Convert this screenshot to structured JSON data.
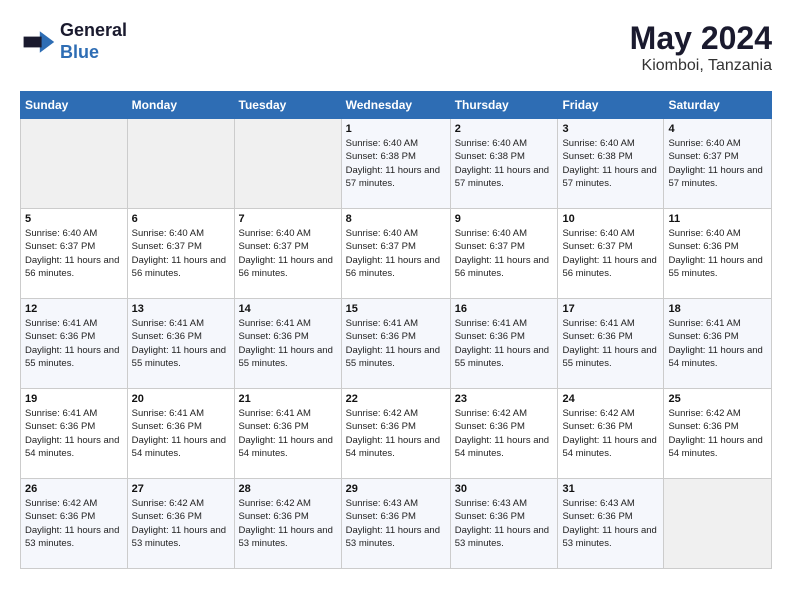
{
  "header": {
    "logo_line1": "General",
    "logo_line2": "Blue",
    "month_year": "May 2024",
    "location": "Kiomboi, Tanzania"
  },
  "days_of_week": [
    "Sunday",
    "Monday",
    "Tuesday",
    "Wednesday",
    "Thursday",
    "Friday",
    "Saturday"
  ],
  "weeks": [
    [
      {
        "day": "",
        "sunrise": "",
        "sunset": "",
        "daylight": "",
        "empty": true
      },
      {
        "day": "",
        "sunrise": "",
        "sunset": "",
        "daylight": "",
        "empty": true
      },
      {
        "day": "",
        "sunrise": "",
        "sunset": "",
        "daylight": "",
        "empty": true
      },
      {
        "day": "1",
        "sunrise": "Sunrise: 6:40 AM",
        "sunset": "Sunset: 6:38 PM",
        "daylight": "Daylight: 11 hours and 57 minutes.",
        "empty": false
      },
      {
        "day": "2",
        "sunrise": "Sunrise: 6:40 AM",
        "sunset": "Sunset: 6:38 PM",
        "daylight": "Daylight: 11 hours and 57 minutes.",
        "empty": false
      },
      {
        "day": "3",
        "sunrise": "Sunrise: 6:40 AM",
        "sunset": "Sunset: 6:38 PM",
        "daylight": "Daylight: 11 hours and 57 minutes.",
        "empty": false
      },
      {
        "day": "4",
        "sunrise": "Sunrise: 6:40 AM",
        "sunset": "Sunset: 6:37 PM",
        "daylight": "Daylight: 11 hours and 57 minutes.",
        "empty": false
      }
    ],
    [
      {
        "day": "5",
        "sunrise": "Sunrise: 6:40 AM",
        "sunset": "Sunset: 6:37 PM",
        "daylight": "Daylight: 11 hours and 56 minutes.",
        "empty": false
      },
      {
        "day": "6",
        "sunrise": "Sunrise: 6:40 AM",
        "sunset": "Sunset: 6:37 PM",
        "daylight": "Daylight: 11 hours and 56 minutes.",
        "empty": false
      },
      {
        "day": "7",
        "sunrise": "Sunrise: 6:40 AM",
        "sunset": "Sunset: 6:37 PM",
        "daylight": "Daylight: 11 hours and 56 minutes.",
        "empty": false
      },
      {
        "day": "8",
        "sunrise": "Sunrise: 6:40 AM",
        "sunset": "Sunset: 6:37 PM",
        "daylight": "Daylight: 11 hours and 56 minutes.",
        "empty": false
      },
      {
        "day": "9",
        "sunrise": "Sunrise: 6:40 AM",
        "sunset": "Sunset: 6:37 PM",
        "daylight": "Daylight: 11 hours and 56 minutes.",
        "empty": false
      },
      {
        "day": "10",
        "sunrise": "Sunrise: 6:40 AM",
        "sunset": "Sunset: 6:37 PM",
        "daylight": "Daylight: 11 hours and 56 minutes.",
        "empty": false
      },
      {
        "day": "11",
        "sunrise": "Sunrise: 6:40 AM",
        "sunset": "Sunset: 6:36 PM",
        "daylight": "Daylight: 11 hours and 55 minutes.",
        "empty": false
      }
    ],
    [
      {
        "day": "12",
        "sunrise": "Sunrise: 6:41 AM",
        "sunset": "Sunset: 6:36 PM",
        "daylight": "Daylight: 11 hours and 55 minutes.",
        "empty": false
      },
      {
        "day": "13",
        "sunrise": "Sunrise: 6:41 AM",
        "sunset": "Sunset: 6:36 PM",
        "daylight": "Daylight: 11 hours and 55 minutes.",
        "empty": false
      },
      {
        "day": "14",
        "sunrise": "Sunrise: 6:41 AM",
        "sunset": "Sunset: 6:36 PM",
        "daylight": "Daylight: 11 hours and 55 minutes.",
        "empty": false
      },
      {
        "day": "15",
        "sunrise": "Sunrise: 6:41 AM",
        "sunset": "Sunset: 6:36 PM",
        "daylight": "Daylight: 11 hours and 55 minutes.",
        "empty": false
      },
      {
        "day": "16",
        "sunrise": "Sunrise: 6:41 AM",
        "sunset": "Sunset: 6:36 PM",
        "daylight": "Daylight: 11 hours and 55 minutes.",
        "empty": false
      },
      {
        "day": "17",
        "sunrise": "Sunrise: 6:41 AM",
        "sunset": "Sunset: 6:36 PM",
        "daylight": "Daylight: 11 hours and 55 minutes.",
        "empty": false
      },
      {
        "day": "18",
        "sunrise": "Sunrise: 6:41 AM",
        "sunset": "Sunset: 6:36 PM",
        "daylight": "Daylight: 11 hours and 54 minutes.",
        "empty": false
      }
    ],
    [
      {
        "day": "19",
        "sunrise": "Sunrise: 6:41 AM",
        "sunset": "Sunset: 6:36 PM",
        "daylight": "Daylight: 11 hours and 54 minutes.",
        "empty": false
      },
      {
        "day": "20",
        "sunrise": "Sunrise: 6:41 AM",
        "sunset": "Sunset: 6:36 PM",
        "daylight": "Daylight: 11 hours and 54 minutes.",
        "empty": false
      },
      {
        "day": "21",
        "sunrise": "Sunrise: 6:41 AM",
        "sunset": "Sunset: 6:36 PM",
        "daylight": "Daylight: 11 hours and 54 minutes.",
        "empty": false
      },
      {
        "day": "22",
        "sunrise": "Sunrise: 6:42 AM",
        "sunset": "Sunset: 6:36 PM",
        "daylight": "Daylight: 11 hours and 54 minutes.",
        "empty": false
      },
      {
        "day": "23",
        "sunrise": "Sunrise: 6:42 AM",
        "sunset": "Sunset: 6:36 PM",
        "daylight": "Daylight: 11 hours and 54 minutes.",
        "empty": false
      },
      {
        "day": "24",
        "sunrise": "Sunrise: 6:42 AM",
        "sunset": "Sunset: 6:36 PM",
        "daylight": "Daylight: 11 hours and 54 minutes.",
        "empty": false
      },
      {
        "day": "25",
        "sunrise": "Sunrise: 6:42 AM",
        "sunset": "Sunset: 6:36 PM",
        "daylight": "Daylight: 11 hours and 54 minutes.",
        "empty": false
      }
    ],
    [
      {
        "day": "26",
        "sunrise": "Sunrise: 6:42 AM",
        "sunset": "Sunset: 6:36 PM",
        "daylight": "Daylight: 11 hours and 53 minutes.",
        "empty": false
      },
      {
        "day": "27",
        "sunrise": "Sunrise: 6:42 AM",
        "sunset": "Sunset: 6:36 PM",
        "daylight": "Daylight: 11 hours and 53 minutes.",
        "empty": false
      },
      {
        "day": "28",
        "sunrise": "Sunrise: 6:42 AM",
        "sunset": "Sunset: 6:36 PM",
        "daylight": "Daylight: 11 hours and 53 minutes.",
        "empty": false
      },
      {
        "day": "29",
        "sunrise": "Sunrise: 6:43 AM",
        "sunset": "Sunset: 6:36 PM",
        "daylight": "Daylight: 11 hours and 53 minutes.",
        "empty": false
      },
      {
        "day": "30",
        "sunrise": "Sunrise: 6:43 AM",
        "sunset": "Sunset: 6:36 PM",
        "daylight": "Daylight: 11 hours and 53 minutes.",
        "empty": false
      },
      {
        "day": "31",
        "sunrise": "Sunrise: 6:43 AM",
        "sunset": "Sunset: 6:36 PM",
        "daylight": "Daylight: 11 hours and 53 minutes.",
        "empty": false
      },
      {
        "day": "",
        "sunrise": "",
        "sunset": "",
        "daylight": "",
        "empty": true
      }
    ]
  ]
}
